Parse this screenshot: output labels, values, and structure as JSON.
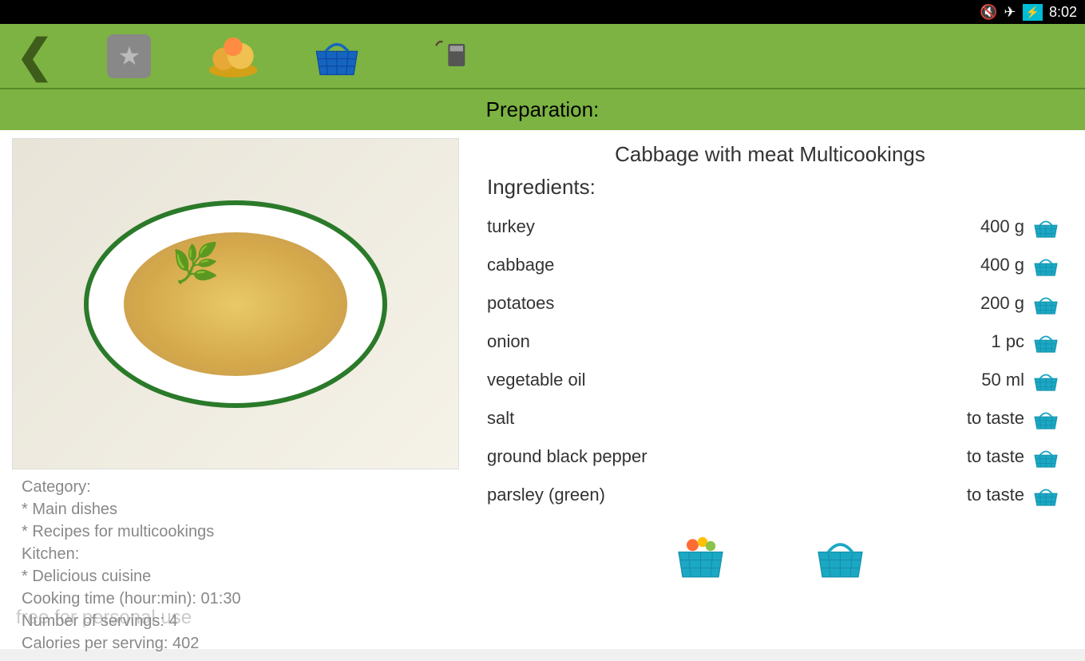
{
  "status": {
    "time": "8:02"
  },
  "section_header": "Preparation:",
  "recipe": {
    "title": "Cabbage with meat Multicookings",
    "ingredients_label": "Ingredients:",
    "ingredients": [
      {
        "name": "turkey",
        "amount": "400 g"
      },
      {
        "name": "cabbage",
        "amount": "400 g"
      },
      {
        "name": "potatoes",
        "amount": "200 g"
      },
      {
        "name": "onion",
        "amount": "1 pc"
      },
      {
        "name": "vegetable oil",
        "amount": "50 ml"
      },
      {
        "name": "salt",
        "amount": "to taste"
      },
      {
        "name": "ground black pepper",
        "amount": "to taste"
      },
      {
        "name": "parsley (green)",
        "amount": "to taste"
      }
    ]
  },
  "meta": {
    "category_label": "Category:",
    "category1": "* Main dishes",
    "category2": "* Recipes for multicookings",
    "kitchen_label": "Kitchen:",
    "kitchen1": "* Delicious cuisine",
    "cooking_time": "Cooking time (hour:min): 01:30",
    "servings": "Number of servings: 4",
    "calories": "Calories per serving: 402"
  },
  "watermark": "free for personal use"
}
